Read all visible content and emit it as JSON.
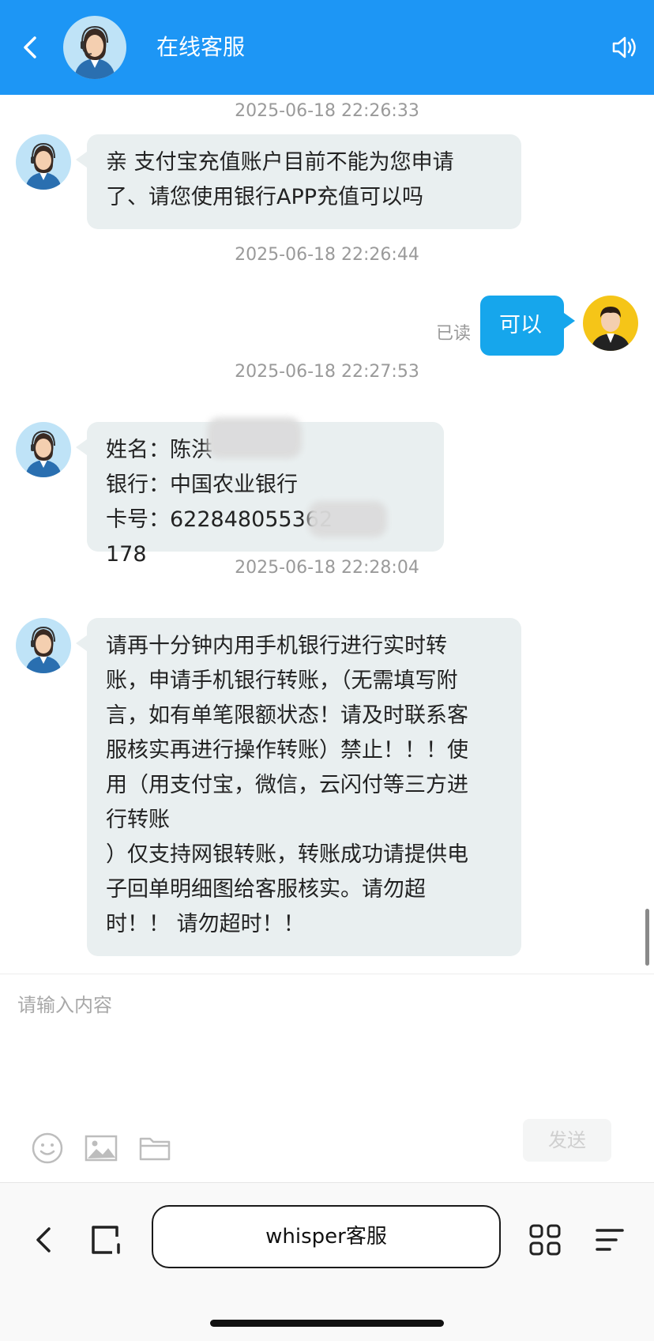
{
  "header": {
    "title": "在线客服",
    "background": "#1d96f5"
  },
  "messages": [
    {
      "timestamp": "2025-06-18 22:26:33",
      "sender": "agent",
      "text": "亲 支付宝充值账户目前不能为您申请\n了、请您使用银行APP充值可以吗"
    },
    {
      "timestamp": "2025-06-18 22:26:44",
      "sender": "user",
      "text": "可以",
      "status": "已读"
    },
    {
      "timestamp": "2025-06-18 22:27:53",
      "sender": "agent",
      "text": "姓名：陈洪\n银行：中国农业银行\n卡号：622848055362　　　178"
    },
    {
      "timestamp": "2025-06-18 22:28:04",
      "sender": "agent",
      "text": "请再十分钟内用手机银行进行实时转\n账，申请手机银行转账，（无需填写附\n言，如有单笔限额状态！请及时联系客\n服核实再进行操作转账）禁止！！！使\n用（用支付宝，微信，云闪付等三方进\n行转账\n）仅支持网银转账，转账成功请提供电\n子回单明细图给客服核实。请勿超\n时！！ 请勿超时！！"
    }
  ],
  "input": {
    "placeholder": "请输入内容",
    "send_label": "发送"
  },
  "toolbar": {
    "icons": [
      "emoji-icon",
      "image-icon",
      "folder-icon"
    ]
  },
  "browser": {
    "address": "whisper客服"
  },
  "colors": {
    "agent_bubble": "#e9eff0",
    "user_bubble": "#16a6ec"
  }
}
